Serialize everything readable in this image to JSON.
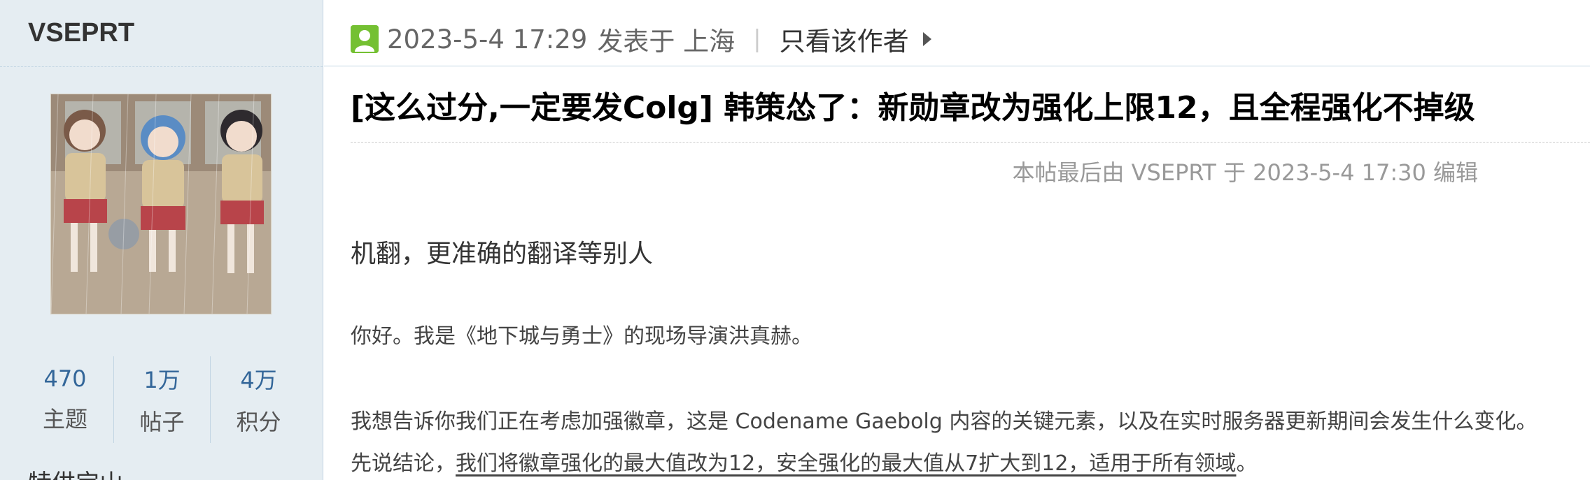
{
  "author": {
    "name": "VSEPRT",
    "stats": [
      {
        "value": "470",
        "label": "主题"
      },
      {
        "value": "1万",
        "label": "帖子"
      },
      {
        "value": "4万",
        "label": "积分"
      }
    ],
    "next_section_label": "特供宝山"
  },
  "post": {
    "meta": {
      "timestamp": "2023-5-4 17:29",
      "posted_in": "发表于 上海",
      "separator": "|",
      "only_author_link": "只看该作者"
    },
    "title": "[这么过分,一定要发Colg] 韩策怂了：新勋章改为强化上限12，且全程强化不掉级",
    "edit_note": "本帖最后由 VSEPRT 于 2023-5-4 17:30 编辑",
    "paragraphs": {
      "p1": "机翻，更准确的翻译等别人",
      "p2": "你好。我是《地下城与勇士》的现场导演洪真赫。",
      "p3": "我想告诉你我们正在考虑加强徽章，这是 Codename Gaebolg 内容的关键元素，以及在实时服务器更新期间会发生什么变化。",
      "p4_prefix": "先说结论，",
      "p4_underlined": "我们将徽章强化的最大值改为12，安全强化的最大值从7扩大到12，适用于所有领域",
      "p4_suffix": "。"
    }
  },
  "colors": {
    "sidebar_bg": "#e5edf2",
    "border": "#c2d5e3",
    "stat_value": "#336699",
    "online_icon": "#74c032"
  }
}
